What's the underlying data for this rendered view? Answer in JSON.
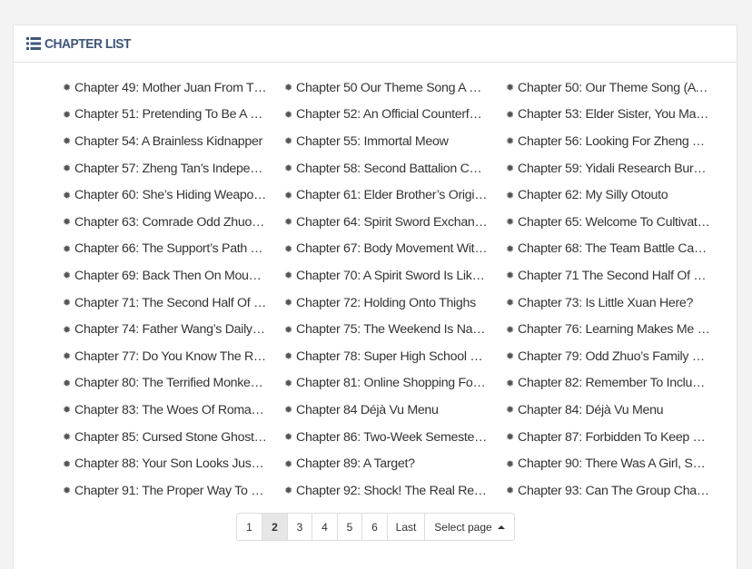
{
  "header": {
    "title": "CHAPTER LIST",
    "icon": "list-icon"
  },
  "chapters": [
    "Chapter 49: Mother Juan From The…",
    "Chapter 50 Our Theme Song A Mus…",
    "Chapter 50: Our Theme Song (A M…",
    "Chapter 51: Pretending To Be A Cu…",
    "Chapter 52: An Official Counterfeit …",
    "Chapter 53: Elder Sister, You May …",
    "Chapter 54: A Brainless Kidnapper",
    "Chapter 55: Immortal Meow",
    "Chapter 56: Looking For Zheng Tan",
    "Chapter 57: Zheng Tan’s Independ…",
    "Chapter 58: Second Battalion Com…",
    "Chapter 59: Yidali Research Burea…",
    "Chapter 60: She’s Hiding Weapons …",
    "Chapter 61: Elder Brother’s Origina…",
    "Chapter 62: My Silly Otouto",
    "Chapter 63: Comrade Odd Zhuo Is …",
    "Chapter 64: Spirit Sword Exchange…",
    "Chapter 65: Welcome To Cultivator’…",
    "Chapter 66: The Support’s Path To…",
    "Chapter 67: Body Movement Witho…",
    "Chapter 68: The Team Battle Can B…",
    "Chapter 69: Back Then On Mount …",
    "Chapter 70: A Spirit Sword Is Like I…",
    "Chapter 71 The Second Half Of “Ji…",
    "Chapter 71: The Second Half Of “Ji…",
    "Chapter 72: Holding Onto Thighs",
    "Chapter 73: Is Little Xuan Here?",
    "Chapter 74: Father Wang’s Daily Lif…",
    "Chapter 75: The Weekend Is Natur…",
    "Chapter 76: Learning Makes Me Ha…",
    "Chapter 77: Do You Know The Rea…",
    "Chapter 78: Super High School Lev…",
    "Chapter 79: Odd Zhuo’s Family Hei…",
    "Chapter 80: The Terrified Monkey C…",
    "Chapter 81: Online Shopping For C…",
    "Chapter 82: Remember To Include …",
    "Chapter 83: The Woes Of Romance",
    "Chapter 84 Déjà Vu Menu",
    "Chapter 84: Déjà Vu Menu",
    "Chapter 85: Cursed Stone Ghost M…",
    "Chapter 86: Two-Week Semester C…",
    "Chapter 87: Forbidden To Keep Do…",
    "Chapter 88: Your Son Looks Just L…",
    "Chapter 89: A Target?",
    "Chapter 90: There Was A Girl, She …",
    "Chapter 91: The Proper Way To Op…",
    "Chapter 92: Shock! The Real Reas…",
    "Chapter 93: Can The Group Chat St…"
  ],
  "pagination": {
    "pages": [
      "1",
      "2",
      "3",
      "4",
      "5",
      "6"
    ],
    "current_page": "2",
    "last_label": "Last",
    "select_label": "Select page"
  }
}
